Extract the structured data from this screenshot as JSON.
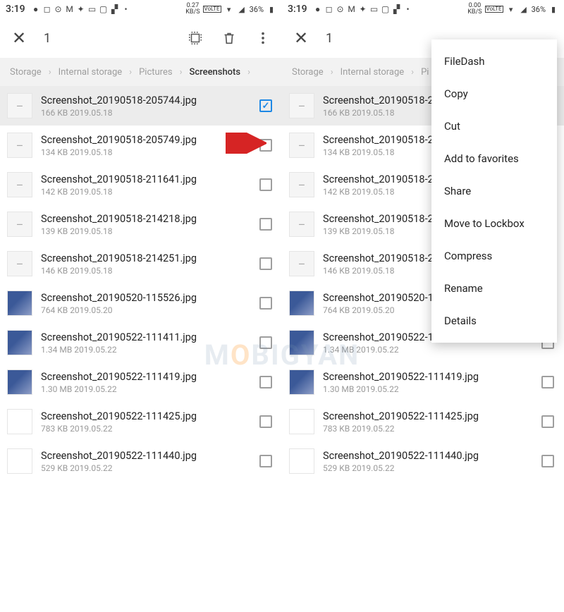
{
  "status": {
    "time": "3:19",
    "kbs_left": "0.27",
    "kbs_left_unit": "KB/S",
    "kbs_right": "0.00",
    "kbs_right_unit": "KB/S",
    "volte": "VoLTE",
    "battery": "36%"
  },
  "toolbar": {
    "count": "1"
  },
  "breadcrumbs": {
    "c1": "Storage",
    "c2": "Internal storage",
    "c3": "Pictures",
    "c4": "Screenshots"
  },
  "files": [
    {
      "name": "Screenshot_20190518-205744.jpg",
      "meta": "166 KB   2019.05.18",
      "checked": true,
      "thumb": "plain"
    },
    {
      "name": "Screenshot_20190518-205749.jpg",
      "meta": "134 KB   2019.05.18",
      "checked": false,
      "thumb": "plain"
    },
    {
      "name": "Screenshot_20190518-211641.jpg",
      "meta": "142 KB   2019.05.18",
      "checked": false,
      "thumb": "plain"
    },
    {
      "name": "Screenshot_20190518-214218.jpg",
      "meta": "139 KB   2019.05.18",
      "checked": false,
      "thumb": "plain"
    },
    {
      "name": "Screenshot_20190518-214251.jpg",
      "meta": "146 KB   2019.05.18",
      "checked": false,
      "thumb": "plain"
    },
    {
      "name": "Screenshot_20190520-115526.jpg",
      "meta": "764 KB   2019.05.20",
      "checked": false,
      "thumb": "img"
    },
    {
      "name": "Screenshot_20190522-111411.jpg",
      "meta": "1.34 MB   2019.05.22",
      "checked": false,
      "thumb": "img"
    },
    {
      "name": "Screenshot_20190522-111419.jpg",
      "meta": "1.30 MB   2019.05.22",
      "checked": false,
      "thumb": "img"
    },
    {
      "name": "Screenshot_20190522-111425.jpg",
      "meta": "783 KB   2019.05.22",
      "checked": false,
      "thumb": "apps"
    },
    {
      "name": "Screenshot_20190522-111440.jpg",
      "meta": "529 KB   2019.05.22",
      "checked": false,
      "thumb": "apps"
    }
  ],
  "menu": {
    "items": [
      "FileDash",
      "Copy",
      "Cut",
      "Add to favorites",
      "Share",
      "Move to Lockbox",
      "Compress",
      "Rename",
      "Details"
    ]
  },
  "watermark": {
    "pre": "M",
    "accent": "O",
    "post": "BIGYAN"
  }
}
